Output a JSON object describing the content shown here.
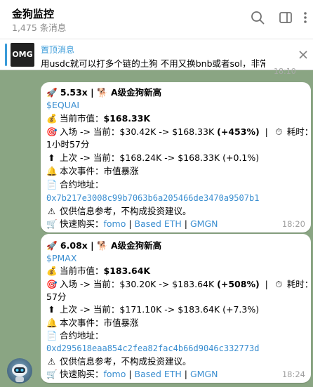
{
  "header": {
    "title": "金狗监控",
    "subtitle": "1,475 条消息"
  },
  "pinned": {
    "label": "置顶消息",
    "text": "用usdc就可以打多个链的土狗 不用又换bnb或者sol，非常...",
    "thumb_text": "OMG"
  },
  "prev_time": "18:10",
  "messages": [
    {
      "headline": "5.53x | 🐕 A级金狗新高",
      "ticker": "$EQUAI",
      "mcap_label": "当前市值：",
      "mcap_value": "$168.33K",
      "entry_label": "入场 -> 当前：",
      "entry_range": "$30.42K -> $168.33K",
      "entry_pct": "(+453%)",
      "elapsed_label": "耗时：",
      "elapsed": "1小时57分",
      "prev_label": "上次 -> 当前：",
      "prev_range": "$168.24K -> $168.33K",
      "prev_pct": "(+0.1%)",
      "event_label": "本次事件：",
      "event": "市值暴涨",
      "contract_label": "合约地址：",
      "contract": "0x7b217e3008c99b7063b6a205466de3470a9507b1",
      "disclaimer": "仅供信息参考，不构成投资建议。",
      "quick_buy_label": "快速购买：",
      "buy_links": [
        "fomo",
        "Based ETH",
        "GMGN"
      ],
      "time": "18:20"
    },
    {
      "headline": "6.08x | 🐕 A级金狗新高",
      "ticker": "$PMAX",
      "mcap_label": "当前市值：",
      "mcap_value": "$183.64K",
      "entry_label": "入场 -> 当前：",
      "entry_range": "$30.20K -> $183.64K",
      "entry_pct": "(+508%)",
      "elapsed_label": "耗时：",
      "elapsed": "57分",
      "prev_label": "上次 -> 当前：",
      "prev_range": "$171.10K -> $183.64K",
      "prev_pct": "(+7.3%)",
      "event_label": "本次事件：",
      "event": "市值暴涨",
      "contract_label": "合约地址：",
      "contract": "0xd295618eaa854c2fea82fac4b66d9046c332773d",
      "disclaimer": "仅供信息参考，不构成投资建议。",
      "quick_buy_label": "快速购买：",
      "buy_links": [
        "fomo",
        "Based ETH",
        "GMGN"
      ],
      "time": "18:24"
    }
  ],
  "icons": {
    "search": "search-icon",
    "sidebar": "sidebar-icon",
    "more": "more-icon",
    "close": "close-icon"
  },
  "colors": {
    "link": "#3a8ed0",
    "accent": "#3a9bd9",
    "chat_bg": "#8aa583"
  }
}
